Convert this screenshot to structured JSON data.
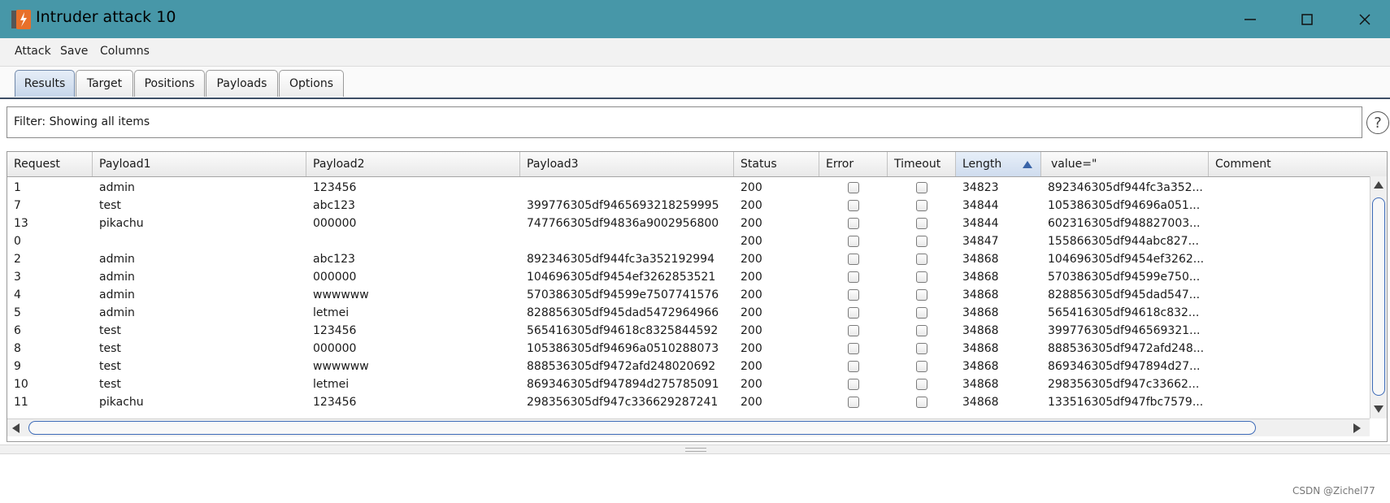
{
  "window": {
    "title": "Intruder attack 10",
    "minimize": "—",
    "maximize": "☐",
    "close": "✕"
  },
  "menu": [
    "Attack",
    "Save",
    "Columns"
  ],
  "tabs": [
    {
      "label": "Results",
      "active": true
    },
    {
      "label": "Target",
      "active": false
    },
    {
      "label": "Positions",
      "active": false
    },
    {
      "label": "Payloads",
      "active": false
    },
    {
      "label": "Options",
      "active": false
    }
  ],
  "filter": {
    "text": "Filter: Showing all items",
    "help": "?"
  },
  "table": {
    "columns": [
      "Request",
      "Payload1",
      "Payload2",
      "Payload3",
      "Status",
      "Error",
      "Timeout",
      "Length",
      "value=\"",
      "Comment"
    ],
    "sorted_column": "Length",
    "rows": [
      [
        "1",
        "admin",
        "123456",
        "",
        "200",
        false,
        false,
        "34823",
        "892346305df944fc3a352..."
      ],
      [
        "7",
        "test",
        "abc123",
        "399776305df9465693218259995",
        "200",
        false,
        false,
        "34844",
        "105386305df94696a051..."
      ],
      [
        "13",
        "pikachu",
        "000000",
        "747766305df94836a9002956800",
        "200",
        false,
        false,
        "34844",
        "602316305df948827003..."
      ],
      [
        "0",
        "",
        "",
        "",
        "200",
        false,
        false,
        "34847",
        "155866305df944abc827..."
      ],
      [
        "2",
        "admin",
        "abc123",
        "892346305df944fc3a352192994",
        "200",
        false,
        false,
        "34868",
        "104696305df9454ef3262..."
      ],
      [
        "3",
        "admin",
        "000000",
        "104696305df9454ef3262853521",
        "200",
        false,
        false,
        "34868",
        "570386305df94599e750..."
      ],
      [
        "4",
        "admin",
        "wwwwww",
        "570386305df94599e7507741576",
        "200",
        false,
        false,
        "34868",
        "828856305df945dad547..."
      ],
      [
        "5",
        "admin",
        "letmei",
        "828856305df945dad5472964966",
        "200",
        false,
        false,
        "34868",
        "565416305df94618c832..."
      ],
      [
        "6",
        "test",
        "123456",
        "565416305df94618c8325844592",
        "200",
        false,
        false,
        "34868",
        "399776305df946569321..."
      ],
      [
        "8",
        "test",
        "000000",
        "105386305df94696a0510288073",
        "200",
        false,
        false,
        "34868",
        "888536305df9472afd248..."
      ],
      [
        "9",
        "test",
        "wwwwww",
        "888536305df9472afd248020692",
        "200",
        false,
        false,
        "34868",
        "869346305df947894d27..."
      ],
      [
        "10",
        "test",
        "letmei",
        "869346305df947894d275785091",
        "200",
        false,
        false,
        "34868",
        "298356305df947c33662..."
      ],
      [
        "11",
        "pikachu",
        "123456",
        "298356305df947c336629287241",
        "200",
        false,
        false,
        "34868",
        "133516305df947fbc7579..."
      ]
    ]
  },
  "watermark": "CSDN @Zichel77",
  "colors": {
    "titlebar": "#4797a8",
    "accent": "#3d6bb8"
  }
}
